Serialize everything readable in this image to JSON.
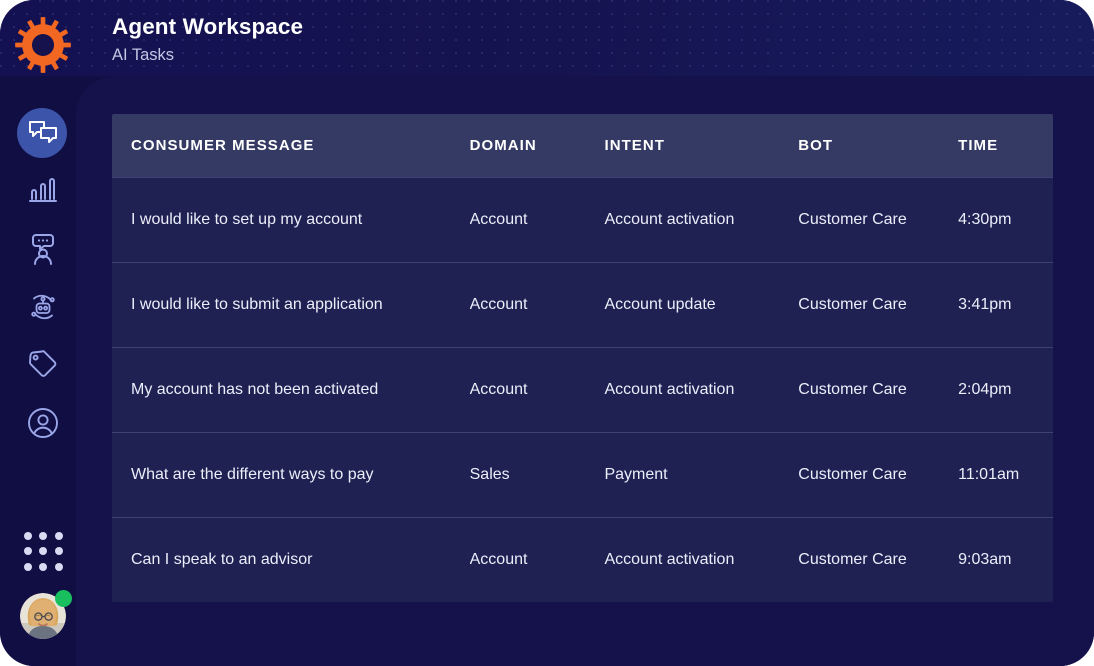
{
  "window": {
    "accent_orange": "#F26722",
    "bg_navy": "#120f4a",
    "header_band": "#15134f",
    "table_header_bg": "#343a63",
    "table_row_bg": "#1e2152",
    "active_nav_bg": "#3d54ab",
    "status_online": "#19bf5e"
  },
  "header": {
    "title": "Agent Workspace",
    "subtitle": "AI Tasks",
    "logo_icon": "gear-icon"
  },
  "sidebar": {
    "items": [
      {
        "icon": "chat-bubbles-icon",
        "name": "conversations",
        "active": true
      },
      {
        "icon": "bar-chart-icon",
        "name": "analytics",
        "active": false
      },
      {
        "icon": "agent-message-icon",
        "name": "agents",
        "active": false
      },
      {
        "icon": "robot-icon",
        "name": "bots",
        "active": false
      },
      {
        "icon": "tag-icon",
        "name": "tags",
        "active": false
      },
      {
        "icon": "user-circle-icon",
        "name": "profile",
        "active": false
      }
    ],
    "app_launcher_icon": "grid-dots-icon",
    "avatar_icon": "user-avatar",
    "status": "online"
  },
  "table": {
    "columns": [
      {
        "key": "message",
        "label": "CONSUMER MESSAGE"
      },
      {
        "key": "domain",
        "label": "DOMAIN"
      },
      {
        "key": "intent",
        "label": "INTENT"
      },
      {
        "key": "bot",
        "label": "BOT"
      },
      {
        "key": "time",
        "label": "TIME"
      }
    ],
    "rows": [
      {
        "message": "I would like to set up my account",
        "domain": "Account",
        "intent": "Account activation",
        "bot": "Customer Care",
        "time": "4:30pm"
      },
      {
        "message": "I would like to submit an application",
        "domain": "Account",
        "intent": "Account update",
        "bot": "Customer Care",
        "time": "3:41pm"
      },
      {
        "message": "My account has not been activated",
        "domain": "Account",
        "intent": "Account activation",
        "bot": "Customer Care",
        "time": "2:04pm"
      },
      {
        "message": "What are the different ways to pay",
        "domain": "Sales",
        "intent": "Payment",
        "bot": "Customer Care",
        "time": "11:01am"
      },
      {
        "message": "Can I speak to an advisor",
        "domain": "Account",
        "intent": "Account activation",
        "bot": "Customer Care",
        "time": "9:03am"
      }
    ]
  }
}
